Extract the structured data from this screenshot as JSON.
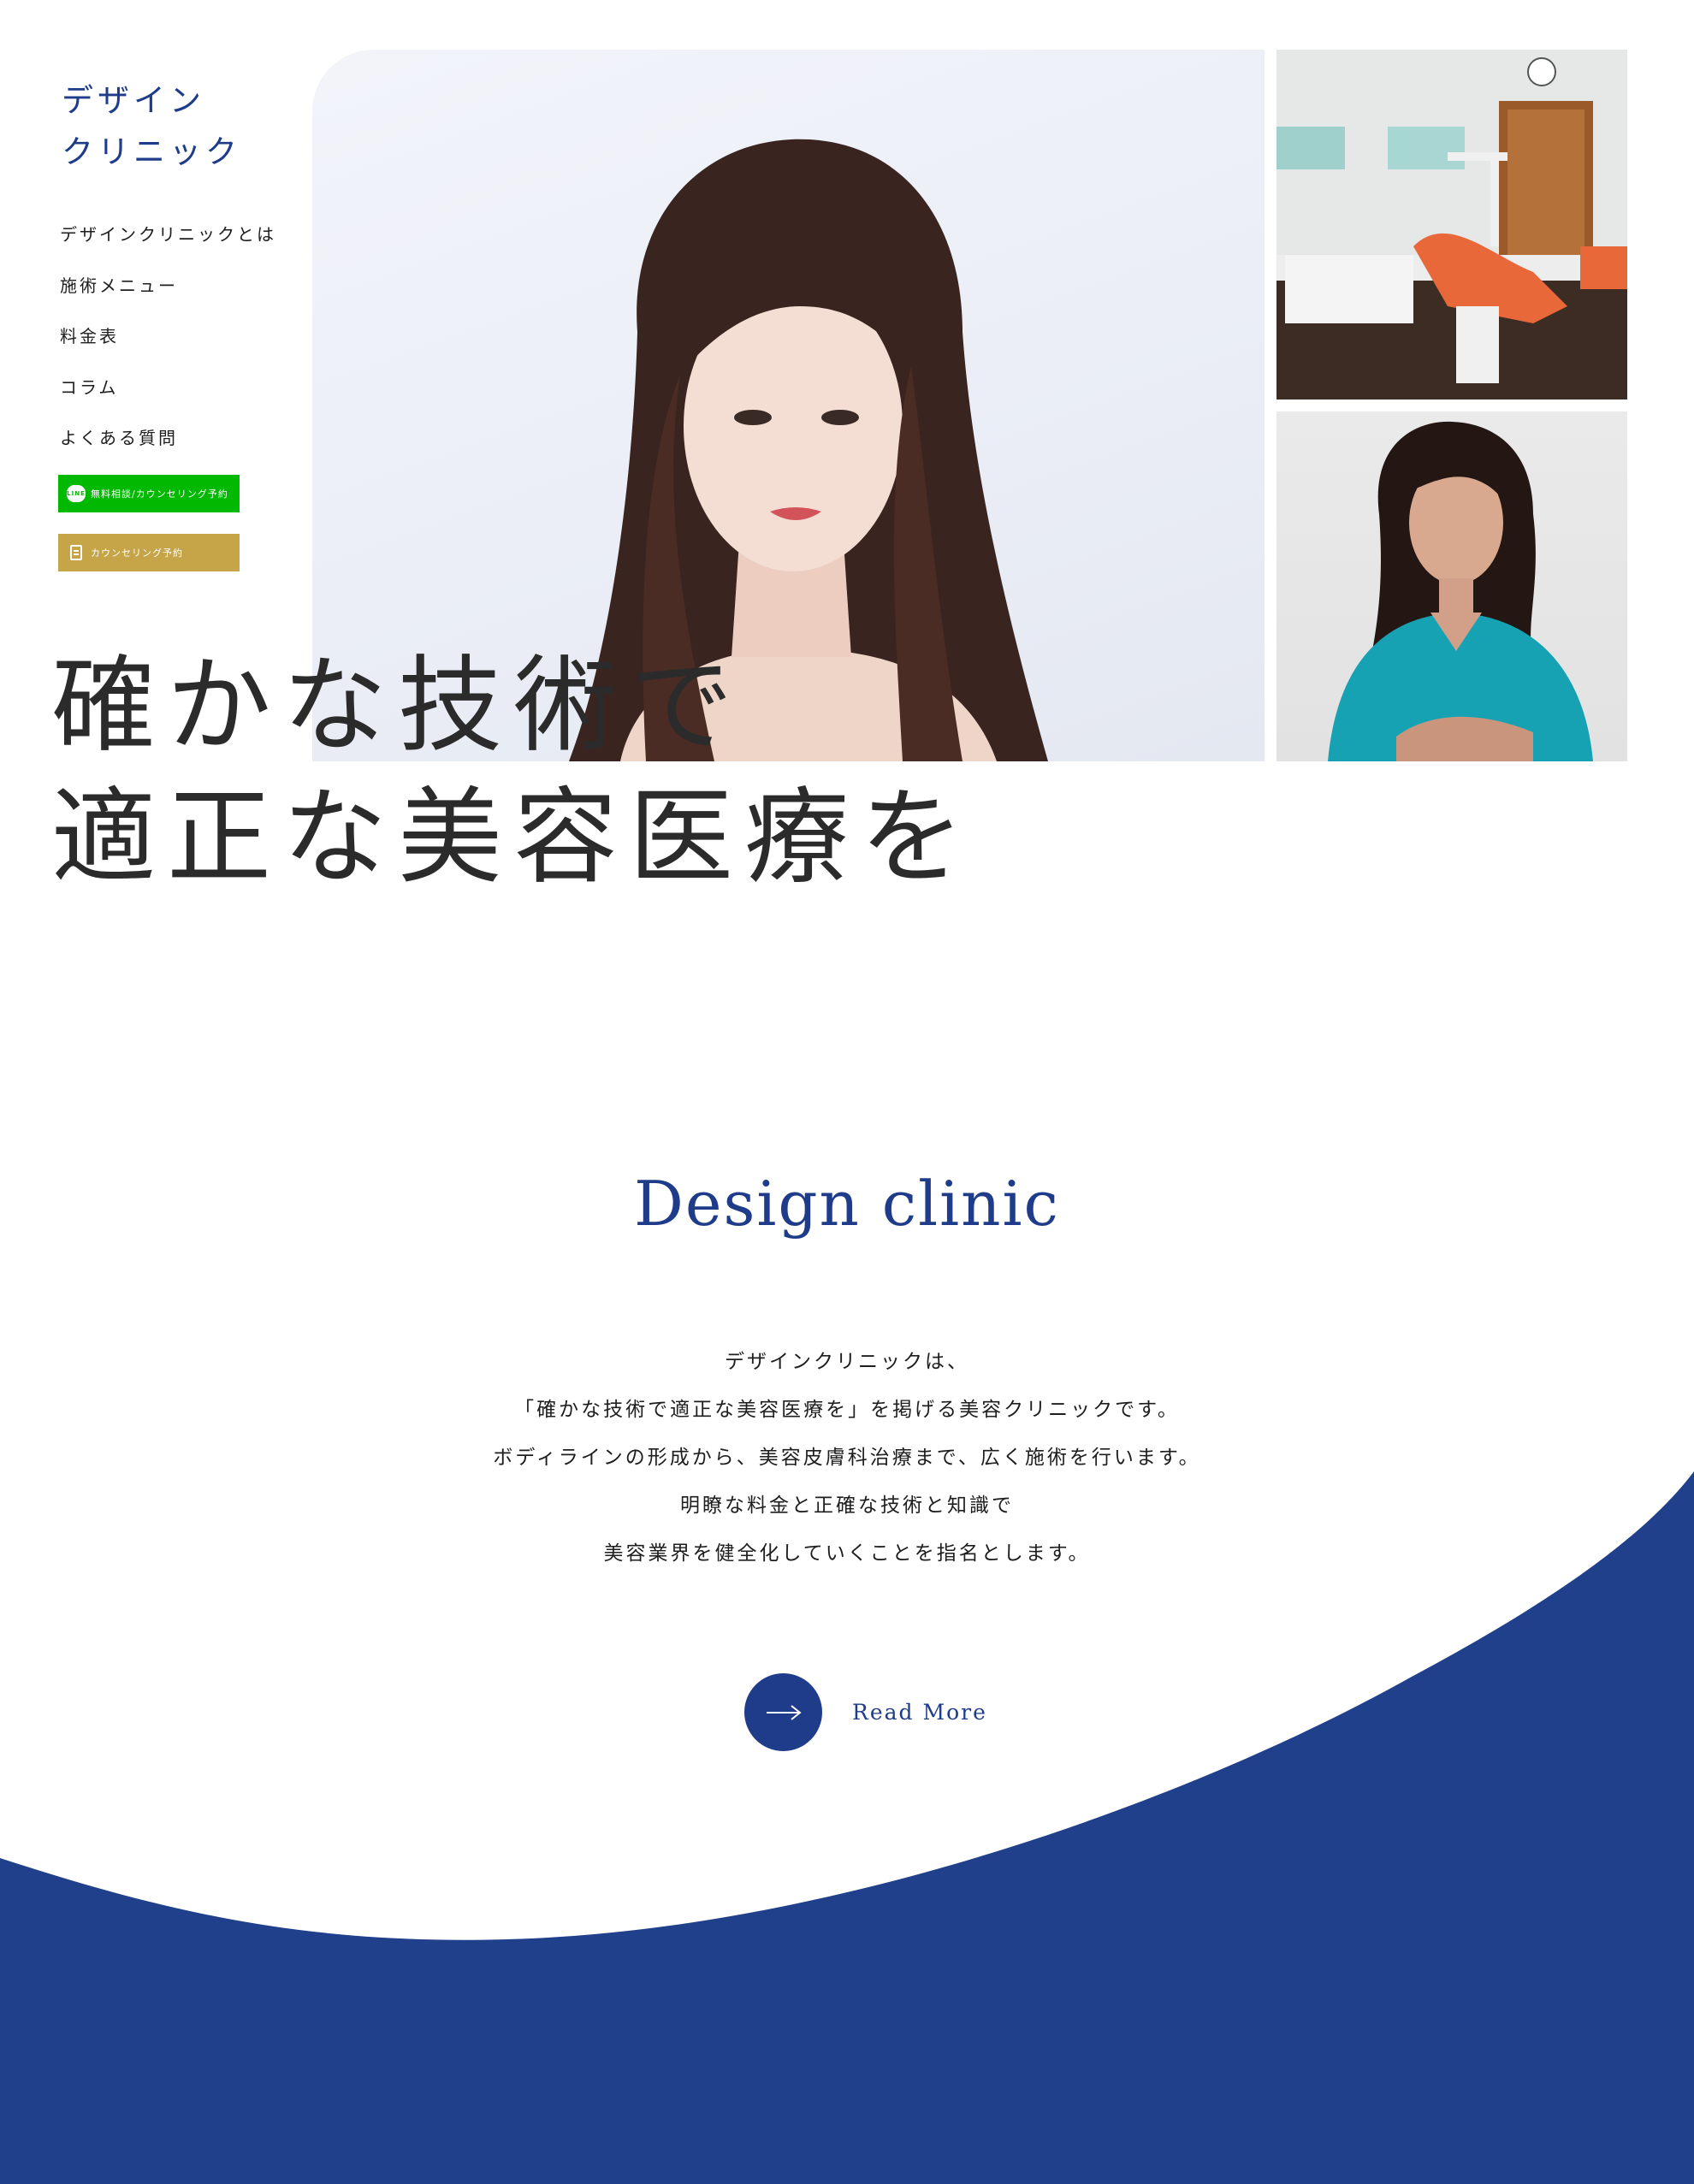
{
  "brand": {
    "line1": "デザイン",
    "line2": "クリニック"
  },
  "nav": {
    "items": [
      {
        "label": "デザインクリニックとは"
      },
      {
        "label": "施術メニュー"
      },
      {
        "label": "料金表"
      },
      {
        "label": "コラム"
      },
      {
        "label": "よくある質問"
      }
    ]
  },
  "cta": {
    "line_icon": "LINE",
    "line_label": "無料相談/カウンセリング予約",
    "counsel_label": "カウンセリング予約"
  },
  "hero": {
    "catch_line1": "確かな技術で",
    "catch_line2": "適正な美容医療を"
  },
  "intro": {
    "title": "Design clinic",
    "lines": [
      "デザインクリニックは、",
      "「確かな技術で適正な美容医療を」を掲げる美容クリニックです。",
      "ボディラインの形成から、美容皮膚科治療まで、広く施術を行います。",
      "明瞭な料金と正確な技術と知識で",
      "美容業界を健全化していくことを指名とします。"
    ],
    "read_more": "Read More"
  },
  "colors": {
    "brand_navy": "#1f3c8a",
    "line_green": "#00b900",
    "gold": "#c6a548",
    "text": "#222222"
  },
  "icons": {
    "line": "line-icon",
    "counsel": "document-icon",
    "read_more": "arrow-right-icon"
  }
}
